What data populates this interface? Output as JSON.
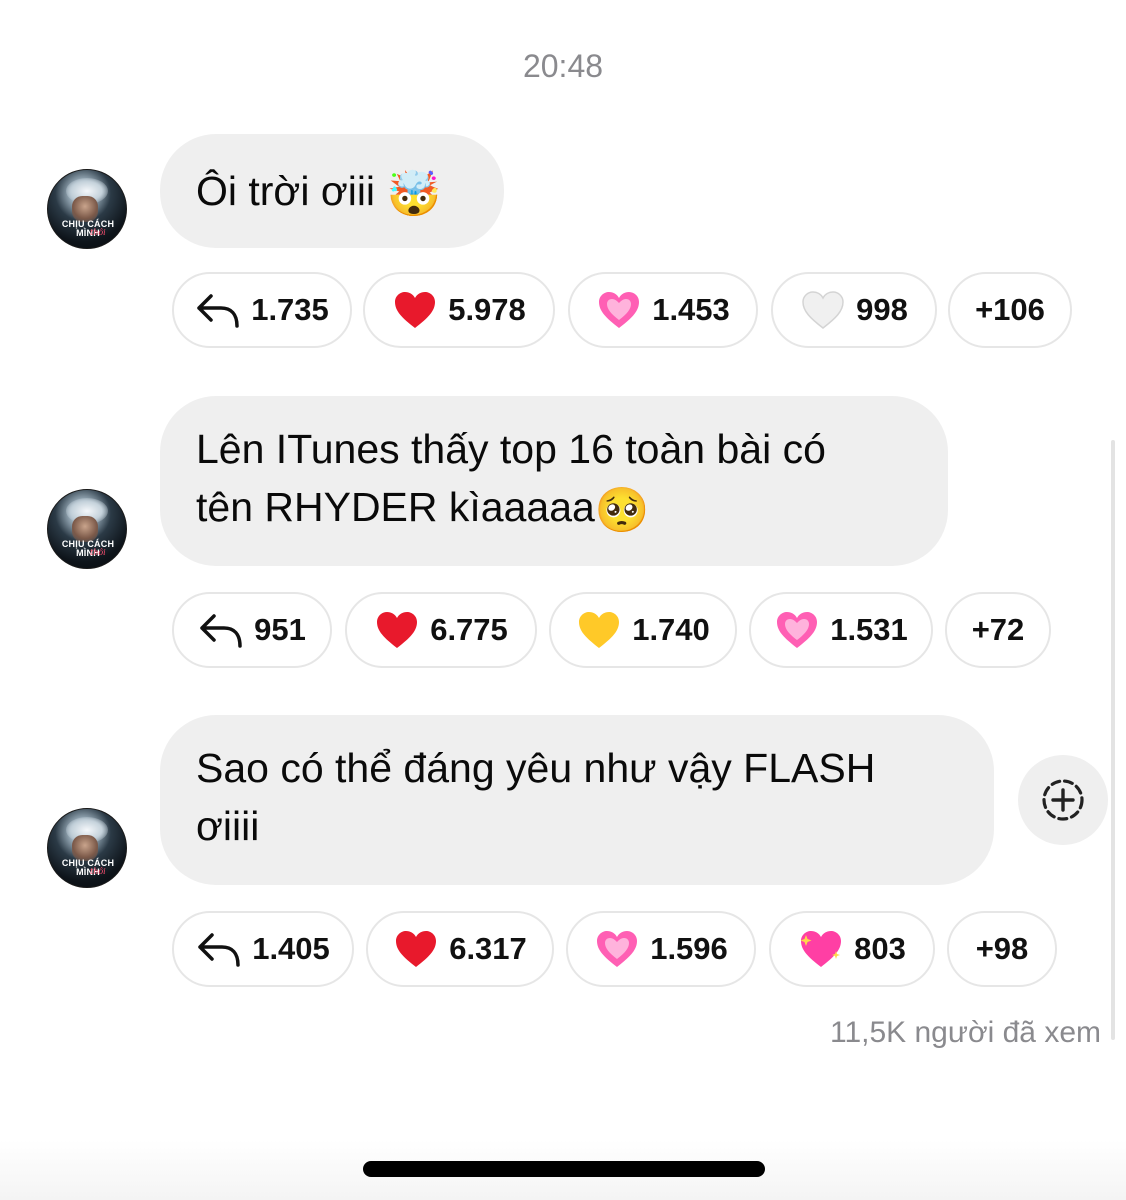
{
  "timestamp": "20:48",
  "avatar": {
    "text_line1": "CHỊU CÁCH",
    "text_line2": "MÌNH",
    "script_text": "thôi"
  },
  "messages": [
    {
      "text": "Ôi trời ơiii",
      "emoji": "🤯",
      "reactions": [
        {
          "icon": "reply-icon",
          "count": "1.735"
        },
        {
          "icon": "red-heart-icon",
          "count": "5.978",
          "color": "#e8192c"
        },
        {
          "icon": "pink-heart-icon",
          "count": "1.453",
          "color": "#ff5fb4"
        },
        {
          "icon": "white-heart-icon",
          "count": "998",
          "color": "#e4e4e4"
        },
        {
          "icon": "",
          "count": "+106"
        }
      ]
    },
    {
      "text": "Lên ITunes thấy top 16 toàn bài có tên RHYDER kìaaaaa",
      "line1": "Lên ITunes thấy top 16 toàn bài có",
      "line2": "tên RHYDER kìaaaaa",
      "emoji": "🥺",
      "reactions": [
        {
          "icon": "reply-icon",
          "count": "951"
        },
        {
          "icon": "red-heart-icon",
          "count": "6.775",
          "color": "#e8192c"
        },
        {
          "icon": "yellow-heart-icon",
          "count": "1.740",
          "color": "#ffc928"
        },
        {
          "icon": "pink-heart-icon",
          "count": "1.531",
          "color": "#ff5fb4"
        },
        {
          "icon": "",
          "count": "+72"
        }
      ]
    },
    {
      "text": "Sao có thể đáng yêu như vậy FLASH ơiiii",
      "line1": "Sao có thể đáng yêu như vậy FLASH",
      "line2": "ơiiii",
      "reactions": [
        {
          "icon": "reply-icon",
          "count": "1.405"
        },
        {
          "icon": "red-heart-icon",
          "count": "6.317",
          "color": "#e8192c"
        },
        {
          "icon": "pink-heart-icon",
          "count": "1.596",
          "color": "#ff5fb4"
        },
        {
          "icon": "sparkling-heart-icon",
          "count": "803",
          "color": "#ff3fa4"
        },
        {
          "icon": "",
          "count": "+98"
        }
      ]
    }
  ],
  "seen_text": "11,5K người đã xem"
}
